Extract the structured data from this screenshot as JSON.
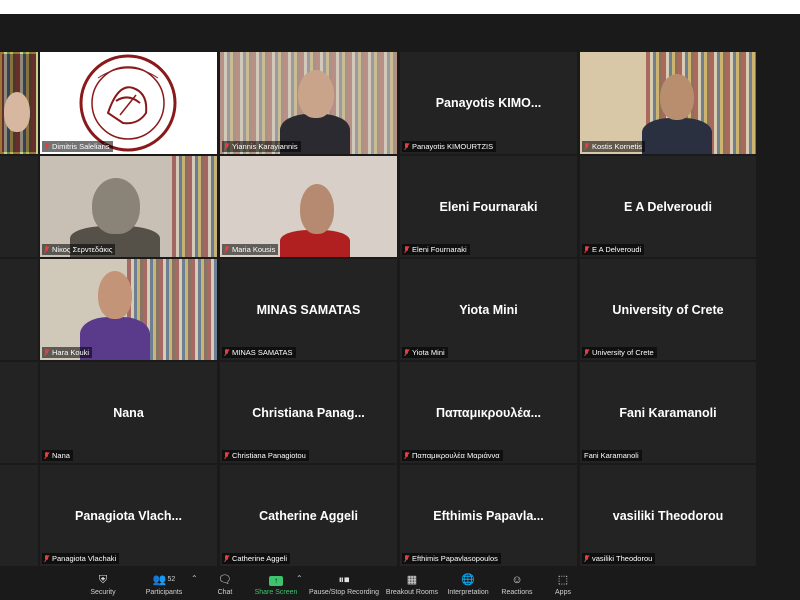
{
  "participants": [
    {
      "label": "",
      "center": "",
      "kind": "video",
      "muted": false
    },
    {
      "label": "Dimitris Saleliaris",
      "center": "",
      "kind": "logo",
      "muted": true
    },
    {
      "label": "Yiannis Karayiannis",
      "center": "",
      "kind": "video",
      "muted": true
    },
    {
      "label": "Panayotis KIMOURTZIS",
      "center": "Panayotis KIMO...",
      "kind": "name",
      "muted": true
    },
    {
      "label": "Kostis Kornetis",
      "center": "",
      "kind": "video",
      "muted": true
    },
    {
      "label": "Νίκος Σερντεδάκις",
      "center": "",
      "kind": "video",
      "muted": true
    },
    {
      "label": "Maria Kousis",
      "center": "",
      "kind": "video",
      "muted": true
    },
    {
      "label": "Eleni Fournaraki",
      "center": "Eleni Fournaraki",
      "kind": "name",
      "muted": true
    },
    {
      "label": "E A Delveroudi",
      "center": "E A Delveroudi",
      "kind": "name",
      "muted": true
    },
    {
      "label": "Hara Kouki",
      "center": "",
      "kind": "video",
      "muted": true
    },
    {
      "label": "MINAS SAMATAS",
      "center": "MINAS SAMATAS",
      "kind": "name",
      "muted": true
    },
    {
      "label": "Yiota Mini",
      "center": "Yiota Mini",
      "kind": "name",
      "muted": true
    },
    {
      "label": "University of Crete",
      "center": "University of Crete",
      "kind": "name",
      "muted": true
    },
    {
      "label": "Nana",
      "center": "Nana",
      "kind": "name",
      "muted": true
    },
    {
      "label": "Christiana Panagiotou",
      "center": "Christiana Panag...",
      "kind": "name",
      "muted": true
    },
    {
      "label": "Παπαμικρουλέα Μαριάννα",
      "center": "Παπαμικρουλέα...",
      "kind": "name",
      "muted": true
    },
    {
      "label": "Fani Karamanoli",
      "center": "Fani Karamanoli",
      "kind": "name",
      "muted": false
    },
    {
      "label": "Panagiota Vlachaki",
      "center": "Panagiota Vlach...",
      "kind": "name",
      "muted": true
    },
    {
      "label": "Catherine Aggeli",
      "center": "Catherine Aggeli",
      "kind": "name",
      "muted": true
    },
    {
      "label": "Efthimis Papavlasopoulos",
      "center": "Efthimis Papavla...",
      "kind": "name",
      "muted": true
    },
    {
      "label": "vasiliki Theodorou",
      "center": "vasiliki Theodorou",
      "kind": "name",
      "muted": true
    }
  ],
  "toolbar": {
    "security": "Security",
    "participants": "Participants",
    "participants_count": "52",
    "chat": "Chat",
    "share_screen": "Share Screen",
    "recording": "Pause/Stop Recording",
    "breakout": "Breakout Rooms",
    "interpretation": "Interpretation",
    "reactions": "Reactions",
    "apps": "Apps"
  },
  "colors": {
    "background": "#1a1a1a",
    "tile": "#232323",
    "active_speaker_border": "#b7d34a",
    "share_green": "#3cc36b",
    "muted_red": "#e04040"
  }
}
